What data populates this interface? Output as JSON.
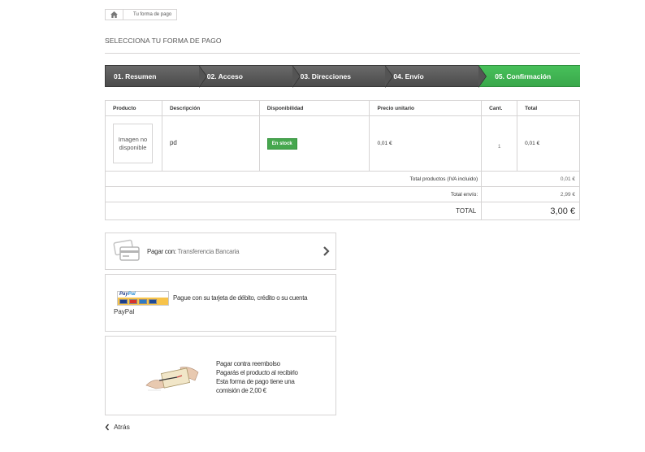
{
  "breadcrumb": {
    "home_icon": "home-icon",
    "current": "Tu forma de pago"
  },
  "heading": "SELECCIONA TU FORMA DE PAGO",
  "steps": [
    {
      "label": "01. Resumen"
    },
    {
      "label": "02. Acceso"
    },
    {
      "label": "03. Direcciones"
    },
    {
      "label": "04. Envío"
    },
    {
      "label": "05. Confirmación"
    }
  ],
  "colors": {
    "active_step": "#47c05a",
    "step": "#5a5a5a",
    "stock_badge": "#46a74e"
  },
  "cart": {
    "headers": {
      "product": "Producto",
      "description": "Descripción",
      "availability": "Disponibilidad",
      "unit_price": "Precio unitario",
      "qty": "Cant.",
      "total": "Total"
    },
    "item": {
      "image_placeholder": "Imagen no disponible",
      "description": "pd",
      "availability": "En stock",
      "unit_price": "0,01 €",
      "qty": "1",
      "total": "0,01 €"
    },
    "summary": {
      "products_label": "Total productos (IVA incluido)",
      "products_value": "0,01 €",
      "shipping_label": "Total envío:",
      "shipping_value": "2,99 €",
      "total_label": "TOTAL",
      "total_value": "3,00 €"
    }
  },
  "payments": {
    "bank": {
      "icon": "credit-card-icon",
      "prefix": "Pagar con: ",
      "method": "Transferencia Bancaria"
    },
    "paypal": {
      "logo_text": "PayPal",
      "description": "Pague con su tarjeta de débito, crédito o su cuenta",
      "name": "PayPal"
    },
    "cod": {
      "line1": "Pagar contra reembolso",
      "line2": "Pagarás el producto al recibirlo",
      "line3": "Esta forma de pago tiene una",
      "line4": "comisión de 2,00 €"
    }
  },
  "back": {
    "label": "Atrás"
  }
}
